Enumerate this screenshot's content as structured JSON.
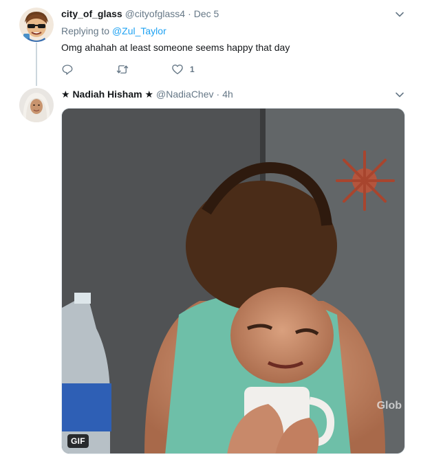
{
  "tweets": [
    {
      "name": "city_of_glass",
      "handle": "@cityofglass4",
      "separator": "·",
      "time": "Dec 5",
      "replying_prefix": "Replying to",
      "replying_to": "@Zul_Taylor",
      "text": "Omg ahahah at least someone seems happy that day",
      "like_count": "1",
      "avatar_icon": "cartoon-avatar-with-sunglasses"
    },
    {
      "name": "★ Nadiah Hisham ★",
      "handle": "@NadiaChev",
      "separator": "·",
      "time": "4h",
      "media": {
        "badge": "GIF",
        "watermark": "Glob"
      },
      "avatar_icon": "woman-in-hijab-photo"
    }
  ],
  "colors": {
    "accent": "#1da1f2",
    "secondary_text": "#657786",
    "primary_text": "#14171a",
    "thread_line": "#ccd6dd"
  }
}
